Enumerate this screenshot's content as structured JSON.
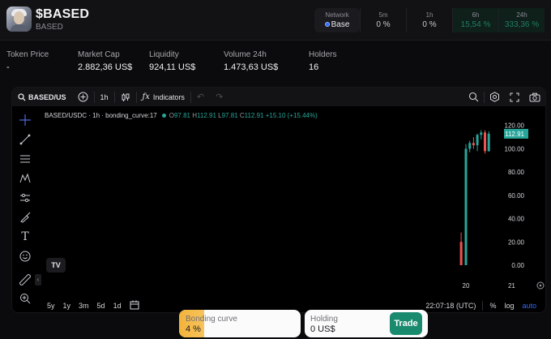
{
  "header": {
    "title": "$BASED",
    "subtitle": "BASED",
    "network": {
      "label": "Network",
      "value": "Base"
    },
    "timeframes": [
      {
        "label": "5m",
        "value": "0 %"
      },
      {
        "label": "1h",
        "value": "0 %"
      },
      {
        "label": "6h",
        "value": "15,54 %"
      },
      {
        "label": "24h",
        "value": "333,36 %"
      }
    ]
  },
  "metrics": [
    {
      "label": "Token Price",
      "value": "-"
    },
    {
      "label": "Market Cap",
      "value": "2.882,36 US$"
    },
    {
      "label": "Liquidity",
      "value": "924,11 US$"
    },
    {
      "label": "Volume 24h",
      "value": "1.473,63 US$"
    },
    {
      "label": "Holders",
      "value": "16"
    }
  ],
  "toolbar": {
    "symbol": "BASED/US",
    "interval": "1h",
    "indicators": "Indicators"
  },
  "legend": {
    "title": "BASED/USDC · 1h · bonding_curve:17",
    "o_label": "O",
    "o": "97.81",
    "h_label": "H",
    "h": "112.91",
    "l_label": "L",
    "l": "97.81",
    "c_label": "C",
    "c": "112.91",
    "change": "+15.10 (+15.44%)"
  },
  "chart_data": {
    "type": "candlestick",
    "y_ticks": [
      "120.00",
      "100.00",
      "80.00",
      "60.00",
      "40.00",
      "20.00",
      "0.00"
    ],
    "ylim": [
      0,
      124
    ],
    "last_price": "112.91",
    "x_ticks": [
      {
        "label": "20",
        "pos": 0.0
      },
      {
        "label": "21",
        "pos": 24.0
      }
    ],
    "candles": [
      {
        "t": -2.5,
        "o": 20,
        "h": 28,
        "l": 0,
        "c": 0
      },
      {
        "t": 0.0,
        "o": 0,
        "h": 104,
        "l": 0,
        "c": 100
      },
      {
        "t": 2.0,
        "o": 100,
        "h": 107,
        "l": 97,
        "c": 105
      },
      {
        "t": 4.0,
        "o": 105,
        "h": 110,
        "l": 100,
        "c": 103
      },
      {
        "t": 6.0,
        "o": 103,
        "h": 113,
        "l": 98,
        "c": 112
      },
      {
        "t": 8.0,
        "o": 112,
        "h": 116,
        "l": 108,
        "c": 114
      },
      {
        "t": 10.0,
        "o": 114,
        "h": 116,
        "l": 96,
        "c": 98
      },
      {
        "t": 12.0,
        "o": 97.81,
        "h": 115,
        "l": 97.81,
        "c": 112.91
      }
    ],
    "colors": {
      "up": "#26a69a",
      "down": "#ef5350"
    }
  },
  "bottom_bar": {
    "ranges": [
      "5y",
      "1y",
      "3m",
      "5d",
      "1d"
    ],
    "clock": "22:07:18 (UTC)",
    "pct": "%",
    "log": "log",
    "auto": "auto"
  },
  "bonding": {
    "label": "Bonding curve",
    "value": "4 %",
    "progress": 0.04
  },
  "holding": {
    "label": "Holding",
    "value": "0 US$",
    "button": "Trade"
  },
  "colors": {
    "accent": "#1a8a6e",
    "bonding": "#f3b33b",
    "up": "#26a69a",
    "down": "#ef5350"
  }
}
